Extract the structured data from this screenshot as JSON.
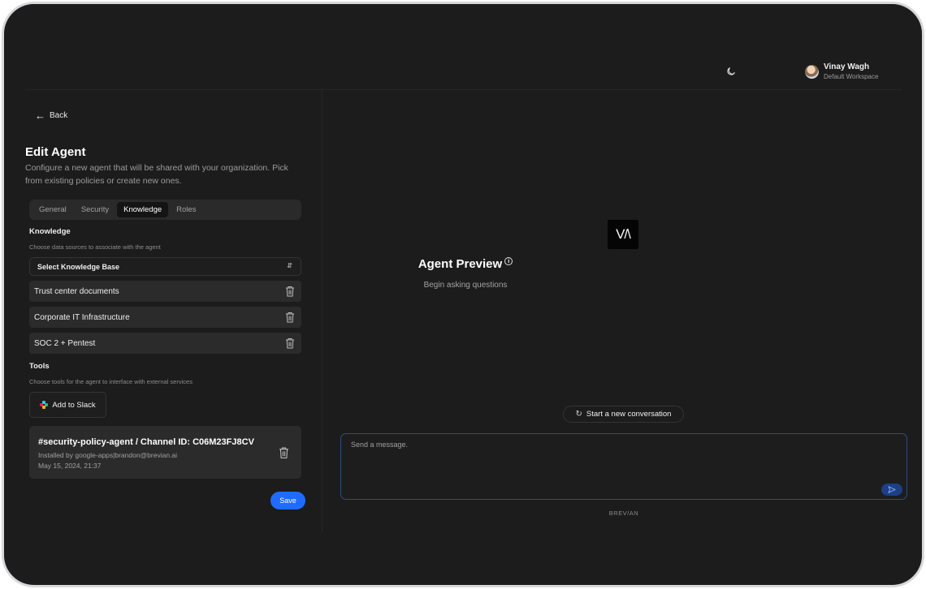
{
  "header": {
    "theme_icon": "moon-icon",
    "user_name": "Vinay Wagh",
    "user_workspace": "Default Workspace"
  },
  "left": {
    "back_label": "Back",
    "title": "Edit Agent",
    "description": "Configure a new agent that will be shared with your organization. Pick from existing policies or create new ones.",
    "tabs": [
      {
        "label": "General"
      },
      {
        "label": "Security"
      },
      {
        "label": "Knowledge",
        "active": true
      },
      {
        "label": "Roles"
      }
    ],
    "knowledge": {
      "title": "Knowledge",
      "subtitle": "Choose data sources to associate with the agent",
      "select_label": "Select Knowledge Base",
      "items": [
        {
          "label": "Trust center documents"
        },
        {
          "label": "Corporate IT Infrastructure"
        },
        {
          "label": "SOC 2 + Pentest"
        }
      ]
    },
    "tools": {
      "title": "Tools",
      "subtitle": "Choose tools for the agent to interface with external services",
      "add_slack_label": "Add to Slack",
      "channel": {
        "name": "#security-policy-agent / Channel ID: C06M23FJ8CV",
        "installed_by": "Installed by google-apps|brandon@brevian.ai",
        "date": "May 15, 2024, 21:37"
      }
    },
    "save_label": "Save"
  },
  "preview": {
    "logo_text": "V/\\",
    "title": "Agent Preview",
    "subtitle": "Begin asking questions",
    "new_conversation_label": "Start a new conversation",
    "message_placeholder": "Send a message.",
    "brand_footer": "BREV/AN"
  },
  "colors": {
    "background": "#1c1c1c",
    "accent": "#1f6bff",
    "card": "#2b2b2b"
  }
}
